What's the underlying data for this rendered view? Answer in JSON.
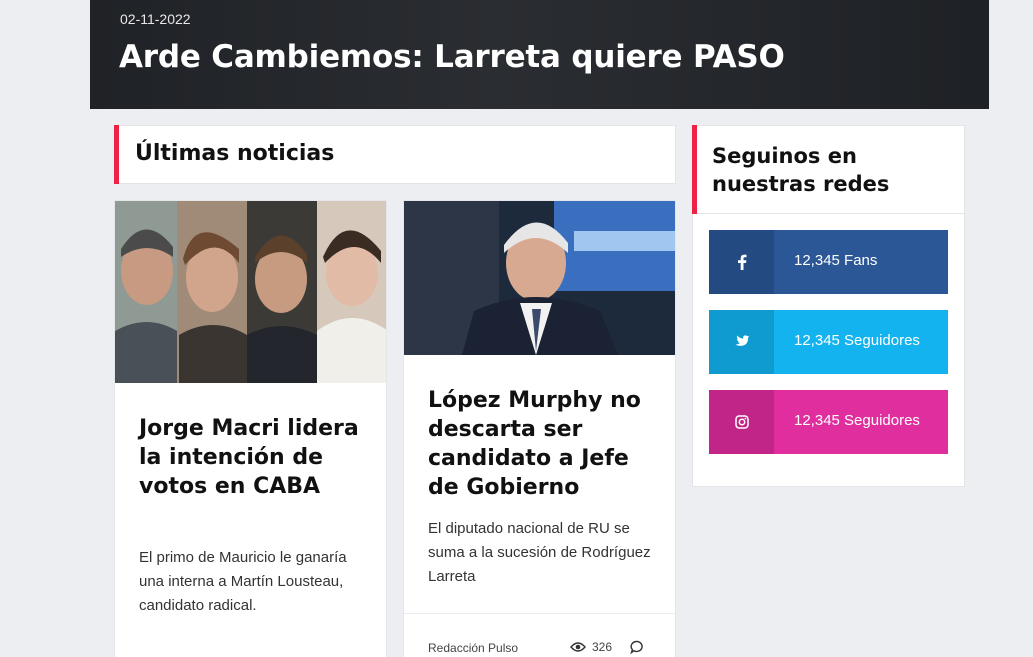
{
  "hero": {
    "date": "02-11-2022",
    "title": "Arde Cambiemos: Larreta quiere PASO"
  },
  "latest": {
    "heading": "Últimas noticias",
    "articles": [
      {
        "title": "Jorge Macri lidera la intención de votos en CABA",
        "excerpt": "El primo de Mauricio le ganaría una interna a Martín Lousteau, candidato radical."
      },
      {
        "title": "López Murphy no descarta ser candidato a Jefe de Gobierno",
        "excerpt": "El diputado nacional de RU se suma a la sucesión de Rodríguez Larreta",
        "author": "Redacción Pulso",
        "views": "326"
      }
    ]
  },
  "sidebar": {
    "heading": "Seguinos en nuestras redes",
    "social": [
      {
        "network": "facebook",
        "icon": "facebook-icon",
        "label": "12,345 Fans",
        "color": "#2b5797",
        "icon_bg": "#244a82"
      },
      {
        "network": "twitter",
        "icon": "twitter-icon",
        "label": "12,345 Seguidores",
        "color": "#12b3ef",
        "icon_bg": "#0f9bd0"
      },
      {
        "network": "instagram",
        "icon": "instagram-icon",
        "label": "12,345 Seguidores",
        "color": "#e02e9e",
        "icon_bg": "#c12587"
      }
    ]
  },
  "colors": {
    "accent": "#ee2244",
    "background": "#eceef1"
  }
}
